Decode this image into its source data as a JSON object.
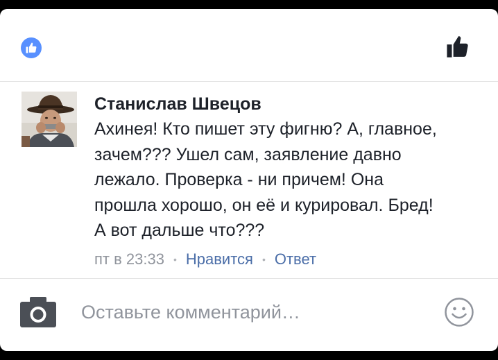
{
  "reactions": {
    "badge_icon": "thumbs-up-icon",
    "badge_color": "#5890ff",
    "like_icon": "thumbs-up-icon"
  },
  "comment": {
    "author": "Станислав Швецов",
    "text": "Ахинея! Кто пишет эту фигню? А, главное,\nзачем??? Ушел сам, заявление давно\nлежало. Проверка - ни причем! Она\nпрошла хорошо, он её и курировал. Бред!\nА вот дальше что???",
    "timestamp": "пт в 23:33",
    "like_label": "Нравится",
    "reply_label": "Ответ",
    "separator": "•",
    "action_color": "#4b6ea8"
  },
  "composer": {
    "camera_icon": "camera-icon",
    "placeholder": "Оставьте комментарий…",
    "value": "",
    "emoji_icon": "smiley-icon"
  }
}
